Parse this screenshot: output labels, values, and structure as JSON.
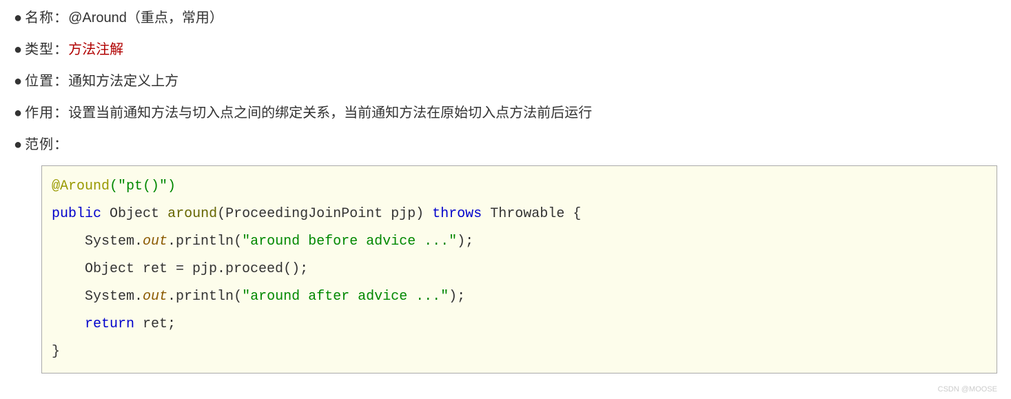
{
  "items": [
    {
      "label": "名称：",
      "value": "@Around（重点，常用）",
      "highlight": false
    },
    {
      "label": "类型：",
      "value": "方法注解",
      "highlight": true
    },
    {
      "label": "位置：",
      "value": "通知方法定义上方",
      "highlight": false
    },
    {
      "label": "作用：",
      "value": "设置当前通知方法与切入点之间的绑定关系，当前通知方法在原始切入点方法前后运行",
      "highlight": false
    },
    {
      "label": "范例：",
      "value": "",
      "highlight": false
    }
  ],
  "code": {
    "annotation": "@Around",
    "annoArg": "(\"pt()\")",
    "kw_public": "public",
    "retType": "Object",
    "methodName": "around",
    "params": "(ProceedingJoinPoint pjp)",
    "kw_throws": "throws",
    "throwType": "Throwable {",
    "sys1": "System.",
    "out": "out",
    "println": ".println(",
    "str1": "\"around before advice ...\"",
    "closeParen": ");",
    "line3": "Object ret = pjp.proceed();",
    "str2": "\"around after advice ...\"",
    "kw_return": "return",
    "retVar": " ret;",
    "closeBrace": "}"
  },
  "watermark": "CSDN @MOOSE"
}
